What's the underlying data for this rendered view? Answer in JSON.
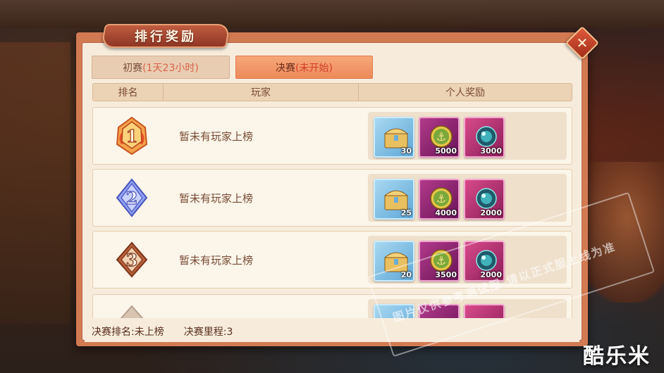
{
  "dialog": {
    "title": "排行奖励",
    "close_label": "✕"
  },
  "tabs": [
    {
      "label": "初赛",
      "status": "(1天23小时)",
      "active": false
    },
    {
      "label": "决赛",
      "status": "(未开始)",
      "active": true
    }
  ],
  "table_header": {
    "rank": "排名",
    "player": "玩家",
    "reward": "个人奖励"
  },
  "rows": [
    {
      "rank": "1",
      "rank_badge_color": "#e8702a",
      "player": "暂未有玩家上榜",
      "rewards": [
        {
          "icon": "treasure-chest-icon",
          "count": "30"
        },
        {
          "icon": "anchor-coin-icon",
          "count": "5000"
        },
        {
          "icon": "crystal-orb-icon",
          "count": "3000"
        }
      ]
    },
    {
      "rank": "2",
      "rank_badge_color": "#6a7ae8",
      "player": "暂未有玩家上榜",
      "rewards": [
        {
          "icon": "treasure-chest-icon",
          "count": "25"
        },
        {
          "icon": "anchor-coin-icon",
          "count": "4000"
        },
        {
          "icon": "crystal-orb-icon",
          "count": "2000"
        }
      ]
    },
    {
      "rank": "3",
      "rank_badge_color": "#b8603a",
      "player": "暂未有玩家上榜",
      "rewards": [
        {
          "icon": "treasure-chest-icon",
          "count": "20"
        },
        {
          "icon": "anchor-coin-icon",
          "count": "3500"
        },
        {
          "icon": "crystal-orb-icon",
          "count": "2000"
        }
      ]
    }
  ],
  "footer": {
    "final_rank_label": "决赛排名:",
    "final_rank_value": "未上榜",
    "final_distance_label": "决赛里程:",
    "final_distance_value": "3"
  },
  "watermark": {
    "text": "图片仅供参考测试服 请以正式服上线为准",
    "logo": "酷乐米"
  }
}
